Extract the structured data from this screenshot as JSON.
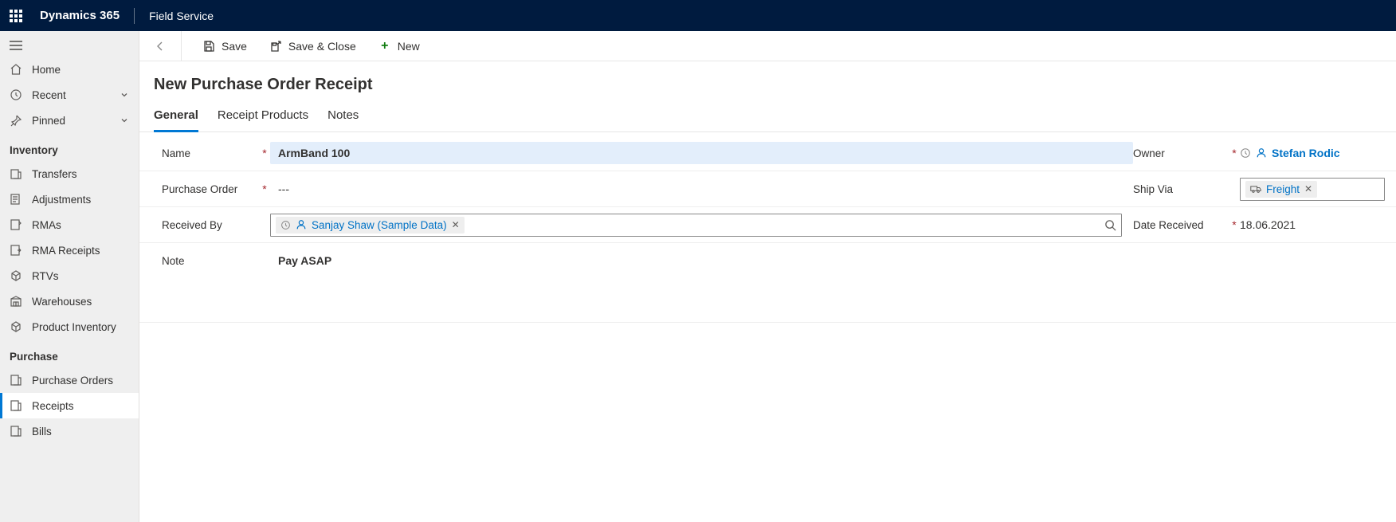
{
  "header": {
    "brand": "Dynamics 365",
    "app": "Field Service"
  },
  "sidebar": {
    "home": "Home",
    "recent": "Recent",
    "pinned": "Pinned",
    "groups": {
      "inventory": {
        "title": "Inventory",
        "items": [
          "Transfers",
          "Adjustments",
          "RMAs",
          "RMA Receipts",
          "RTVs",
          "Warehouses",
          "Product Inventory"
        ]
      },
      "purchase": {
        "title": "Purchase",
        "items": [
          "Purchase Orders",
          "Receipts",
          "Bills"
        ]
      }
    }
  },
  "commands": {
    "save": "Save",
    "save_close": "Save & Close",
    "new": "New"
  },
  "page": {
    "title": "New Purchase Order Receipt",
    "tabs": [
      "General",
      "Receipt Products",
      "Notes"
    ],
    "active_tab": 0
  },
  "form": {
    "labels": {
      "name": "Name",
      "purchase_order": "Purchase Order",
      "received_by": "Received By",
      "note": "Note",
      "owner": "Owner",
      "ship_via": "Ship Via",
      "date_received": "Date Received"
    },
    "values": {
      "name": "ArmBand 100",
      "purchase_order": "---",
      "received_by": "Sanjay Shaw (Sample Data)",
      "note": "Pay ASAP",
      "owner": "Stefan Rodic",
      "ship_via": "Freight",
      "date_received": "18.06.2021"
    }
  }
}
